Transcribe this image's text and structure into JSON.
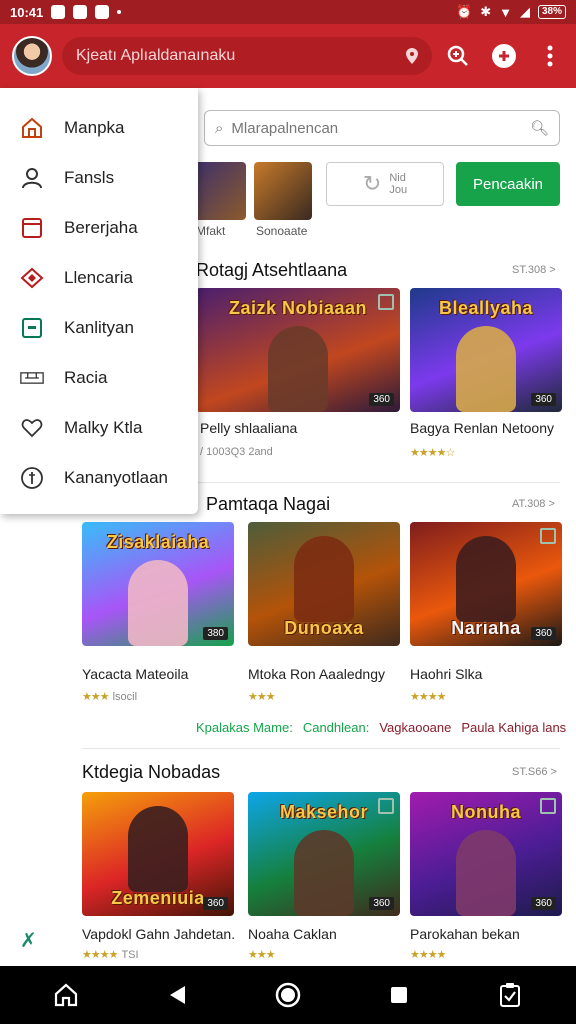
{
  "status_bar": {
    "time": "10:41",
    "battery": "38%"
  },
  "app_bar": {
    "search_placeholder": "Kjeatı Aplıaldanaınaku",
    "avatar": "user-avatar",
    "actions": [
      "search-plus-icon",
      "add-circle-icon",
      "overflow-menu-icon"
    ]
  },
  "drawer": {
    "items": [
      {
        "label": "Manpka",
        "icon": "home-icon",
        "color": "#c2410c"
      },
      {
        "label": "Fansls",
        "icon": "person-icon",
        "color": "#333333"
      },
      {
        "label": "Bererjaha",
        "icon": "window-icon",
        "color": "#b91c1c"
      },
      {
        "label": "Llencaria",
        "icon": "diamond-icon",
        "color": "#b91c1c"
      },
      {
        "label": "Kanlityan",
        "icon": "square-box-icon",
        "color": "#047857"
      },
      {
        "label": "Racia",
        "icon": "keyboard-icon",
        "color": "#333333"
      },
      {
        "label": "Malky Ktla",
        "icon": "heart-outline-icon",
        "color": "#333333"
      },
      {
        "label": "Kananyotlaan",
        "icon": "coin-icon",
        "color": "#333333"
      }
    ]
  },
  "content": {
    "search_placeholder": "Mlarapalnencan",
    "chips": [
      {
        "label": "Mfakt"
      },
      {
        "label": "Sonoaate"
      }
    ],
    "ghost_button": {
      "line1": "Nid",
      "line2": "Jou"
    },
    "green_button": "Pencaakin",
    "sections": [
      {
        "title": "Rotagj Atsehtlaana",
        "more": "ST.308 >",
        "cards": [
          {
            "art": "Zaizk Nobiaaan",
            "badge": "360",
            "name": "Pelly shlaaliana",
            "meta": "/ 1003Q3 2and",
            "stars": ""
          },
          {
            "art": "Bleallyaha",
            "badge": "360",
            "name": "Bagya Renlan Netoony",
            "meta": "",
            "stars": "★★★★☆"
          }
        ]
      },
      {
        "title": "Pamtaqa Nagai",
        "more": "AT.308 >",
        "cards": [
          {
            "art": "Zisaklaiaha",
            "badge": "380",
            "name": "Yacacta Mateoila",
            "meta": "lsocil",
            "stars": "★★★"
          },
          {
            "art": "Dunoaxa",
            "badge": "",
            "name": "Mtoka Ron Aaaledngy",
            "meta": "",
            "stars": "★★★"
          },
          {
            "art": "Nariaha",
            "badge": "360",
            "name": "Haohri Slka",
            "meta": "",
            "stars": "★★★★"
          }
        ]
      },
      {
        "title": "Ktdegia Nobadas",
        "more": "ST.S66 >",
        "cards": [
          {
            "art": "Zemeniuia",
            "badge": "360",
            "name": "Vapdokl Gahn Jahdetan.",
            "meta": "TSI",
            "stars": "★★★★"
          },
          {
            "art": "Maksehor",
            "badge": "360",
            "name": "Noaha Caklan",
            "meta": "",
            "stars": "★★★"
          },
          {
            "art": "Nonuha",
            "badge": "360",
            "name": "Parokahan bekan",
            "meta": "",
            "stars": "★★★★"
          }
        ]
      }
    ],
    "links": [
      {
        "label": "Kpalakas Mame:",
        "color": "green"
      },
      {
        "label": "Candhlean:",
        "color": "green"
      },
      {
        "label": "Vagkaooane",
        "color": "maroon"
      },
      {
        "label": "Paula Kahiga lans",
        "color": "maroon"
      }
    ]
  },
  "nav_bar": [
    "home-icon",
    "back-icon",
    "circle-home-icon",
    "recents-icon",
    "clipboard-check-icon"
  ]
}
